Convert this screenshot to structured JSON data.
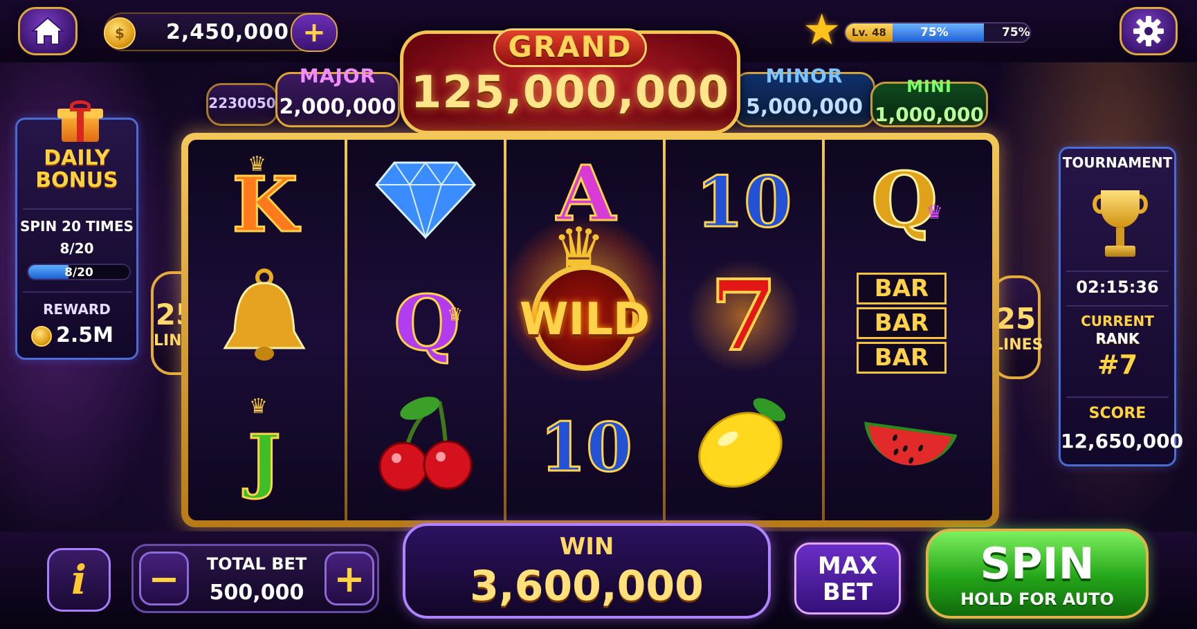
{
  "top": {
    "coins": "2,450,000",
    "level": {
      "badge": "Lv. 48",
      "progress_percent": 75,
      "bar_text": "75%",
      "right_text": "75%"
    }
  },
  "jackpots": {
    "grand": {
      "label": "GRAND",
      "value": "125,000,000"
    },
    "major": {
      "label": "MAJOR",
      "value": "2,000,000"
    },
    "extra": {
      "label": "",
      "value": "2230050"
    },
    "minor": {
      "label": "MINOR",
      "value": "5,000,000"
    },
    "mini": {
      "label": "MINI",
      "value": "1,000,000"
    }
  },
  "daily_bonus": {
    "title_line1": "DAILY",
    "title_line2": "BONUS",
    "task": "SPIN 20 TIMES",
    "count": "8/20",
    "progress_fraction": 0.4,
    "bar_text": "8/20",
    "reward_label": "REWARD",
    "reward_value": "2.5M"
  },
  "lines": {
    "count": "25",
    "label": "LINES"
  },
  "reels": [
    [
      "K",
      "bell",
      "J"
    ],
    [
      "diamond",
      "Q",
      "cherry"
    ],
    [
      "A",
      "WILD",
      "10"
    ],
    [
      "10",
      "7",
      "lemon"
    ],
    [
      "Q",
      "BAR",
      "watermelon"
    ]
  ],
  "symbol_text": {
    "wild": "WILD",
    "bar": "BAR"
  },
  "tournament": {
    "title": "TOURNAMENT",
    "timer": "02:15:36",
    "rank_label": "CURRENT RANK",
    "rank_label2": "RANK",
    "rank_value": "#7",
    "score_label": "SCORE",
    "score_value": "12,650,000"
  },
  "bottom": {
    "info_label": "i",
    "bet_label": "TOTAL BET",
    "bet_value": "500,000",
    "minus": "−",
    "plus": "+",
    "win_label": "WIN",
    "win_value": "3,600,000",
    "max_bet_line1": "MAX",
    "max_bet_line2": "BET",
    "spin_label": "SPIN",
    "spin_sub": "HOLD FOR AUTO"
  },
  "colors": {
    "gold": "#f3c550",
    "grand_red": "#c0202a",
    "spin_green": "#23a418",
    "panel_blue": "#4b6bd6"
  }
}
